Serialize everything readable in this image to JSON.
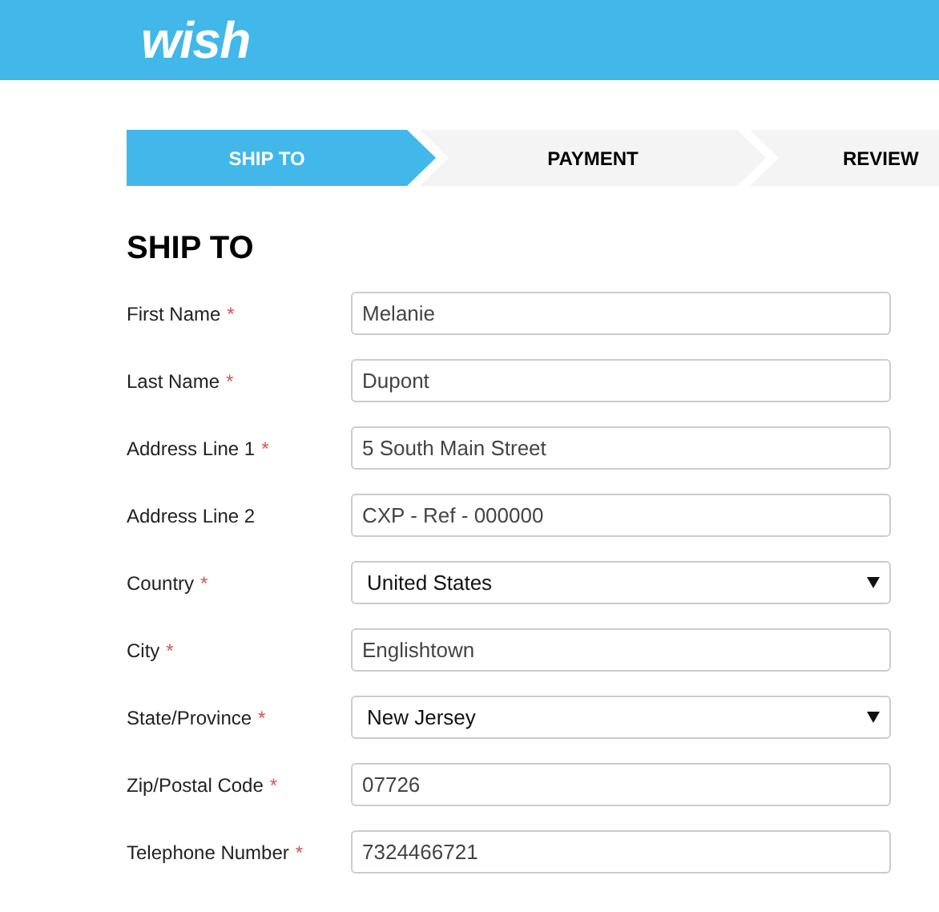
{
  "header": {
    "logo": "wish"
  },
  "steps": [
    {
      "label": "SHIP TO",
      "selected": true
    },
    {
      "label": "PAYMENT",
      "selected": false
    },
    {
      "label": "REVIEW",
      "selected": false
    }
  ],
  "section_title": "SHIP TO",
  "fields": [
    {
      "label": "First Name",
      "required_mark": "*",
      "kind": "text",
      "value": "Melanie"
    },
    {
      "label": "Last Name",
      "required_mark": "*",
      "kind": "text",
      "value": "Dupont"
    },
    {
      "label": "Address Line 1",
      "required_mark": "*",
      "kind": "text",
      "value": "5 South Main Street"
    },
    {
      "label": "Address Line 2",
      "kind": "text",
      "value": "CXP - Ref - 000000"
    },
    {
      "label": "Country",
      "required_mark": "*",
      "kind": "select",
      "value": "United States"
    },
    {
      "label": "City",
      "required_mark": "*",
      "kind": "text",
      "value": "Englishtown"
    },
    {
      "label": "State/Province",
      "required_mark": "*",
      "kind": "select",
      "value": "New Jersey"
    },
    {
      "label": "Zip/Postal Code",
      "required_mark": "*",
      "kind": "text",
      "value": "07726"
    },
    {
      "label": "Telephone Number",
      "required_mark": "*",
      "kind": "text",
      "value": "7324466721"
    }
  ]
}
